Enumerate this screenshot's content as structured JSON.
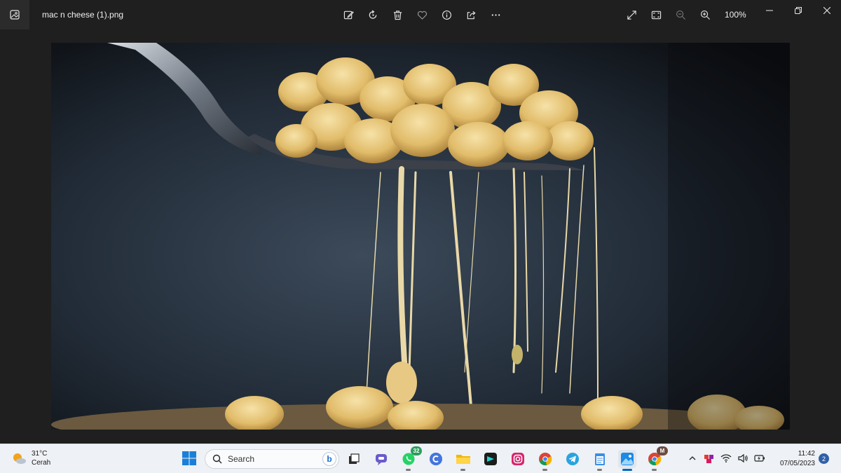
{
  "window": {
    "filename": "mac n cheese (1).png",
    "zoom": "100%"
  },
  "toolbar": {
    "buttons": [
      "edit-image",
      "rotate",
      "delete",
      "favorite",
      "file-info",
      "share",
      "see-more"
    ],
    "right_buttons": [
      "full-screen",
      "fit-to-window",
      "zoom-out",
      "zoom-in"
    ]
  },
  "taskbar": {
    "weather_temp": "31°C",
    "weather_desc": "Cerah",
    "search_placeholder": "Search",
    "whatsapp_badge": "32",
    "chrome_profile_badge": "M",
    "time": "11:42",
    "date": "07/05/2023",
    "notification_count": "2",
    "accent": "#0067c0"
  }
}
